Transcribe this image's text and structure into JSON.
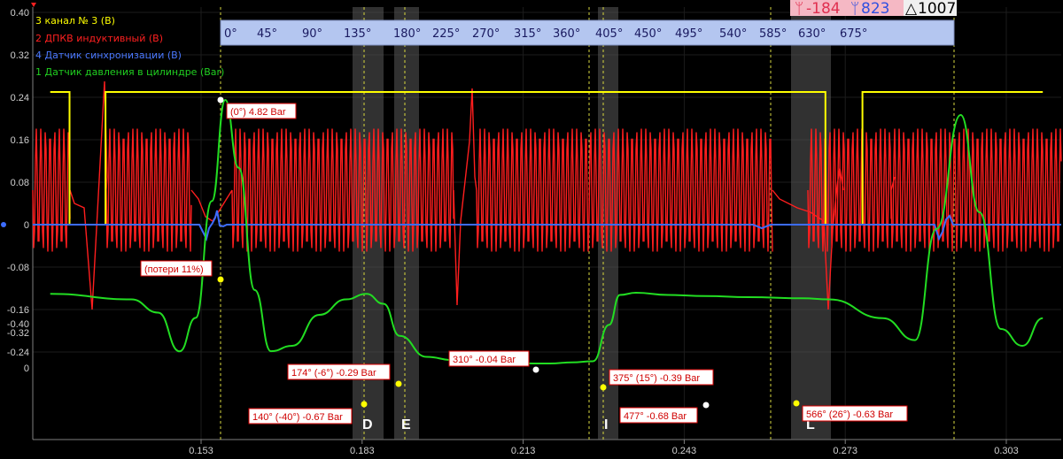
{
  "chart_data": {
    "type": "line",
    "x_ticks": [
      "0.153",
      "0.183",
      "0.213",
      "0.243",
      "0.273",
      "0.303"
    ],
    "y_ticks_voltage": [
      "0.40",
      "0.32",
      "0.24",
      "0.16",
      "0.08",
      "0",
      "-0.08",
      "-0.16",
      "-0.24"
    ],
    "y_ticks_pressure": [
      "0",
      "-0.32",
      "-0.40"
    ],
    "legend": [
      {
        "name": "3 канал № 3 (В)",
        "color": "#ffff00"
      },
      {
        "name": "2 ДПКВ индуктивный (В)",
        "color": "#ff2020"
      },
      {
        "name": "4 Датчик синхронизации (В)",
        "color": "#3c6cff"
      },
      {
        "name": "1 Датчик давления в цилиндре  (Bar)",
        "color": "#20d020"
      }
    ],
    "degree_scale": [
      "0°",
      "45°",
      "90°",
      "135°",
      "180°",
      "225°",
      "270°",
      "315°",
      "360°",
      "405°",
      "450°",
      "495°",
      "540°",
      "585°",
      "630°",
      "675°"
    ],
    "header": {
      "cursor_a": "-184",
      "cursor_b": "823",
      "delta": "1007"
    },
    "zones": [
      "D",
      "E",
      "I",
      "L"
    ],
    "annotations": [
      "(0°) 4.82 Bar",
      "(потери 11%)",
      "174° (-6°) -0.29 Bar",
      "140° (-40°) -0.67 Bar",
      "310° -0.04 Bar",
      "375° (15°) -0.39 Bar",
      "477° -0.68 Bar",
      "566° (26°) -0.63 Bar"
    ],
    "series": [
      {
        "name": "1 Датчик давления в цилиндре  (Bar)",
        "x": [
          0.1249,
          0.14,
          0.145,
          0.149,
          0.152,
          0.155,
          0.1575,
          0.16,
          0.163,
          0.166,
          0.17,
          0.175,
          0.18,
          0.1838,
          0.187,
          0.19,
          0.195,
          0.2,
          0.205,
          0.21,
          0.215,
          0.218,
          0.222,
          0.226,
          0.229,
          0.231,
          0.234,
          0.24,
          0.247,
          0.255,
          0.265,
          0.27,
          0.28,
          0.286,
          0.29,
          0.2945,
          0.298,
          0.302,
          0.306,
          0.3098
        ],
        "y": [
          -0.67,
          -0.62,
          -0.5,
          -0.15,
          0.9,
          3.0,
          4.82,
          3.6,
          1.4,
          0.3,
          -0.2,
          -0.48,
          -0.62,
          -0.67,
          -0.58,
          -0.29,
          -0.1,
          -0.07,
          -0.06,
          -0.05,
          -0.04,
          -0.04,
          -0.05,
          -0.06,
          -0.39,
          -0.66,
          -0.68,
          -0.66,
          -0.65,
          -0.64,
          -0.63,
          -0.62,
          -0.45,
          0.5,
          2.5,
          4.55,
          2.8,
          0.7,
          -0.2,
          -0.45
        ]
      },
      {
        "name": "3 канал № 3 (В)",
        "x": [
          0.1249,
          0.1285,
          0.1285,
          0.1352,
          0.1352,
          0.2693,
          0.2693,
          0.2762,
          0.2762,
          0.3098
        ],
        "y": [
          0.25,
          0.25,
          0.0,
          0.0,
          0.25,
          0.25,
          0.0,
          0.0,
          0.25,
          0.25
        ]
      }
    ]
  }
}
